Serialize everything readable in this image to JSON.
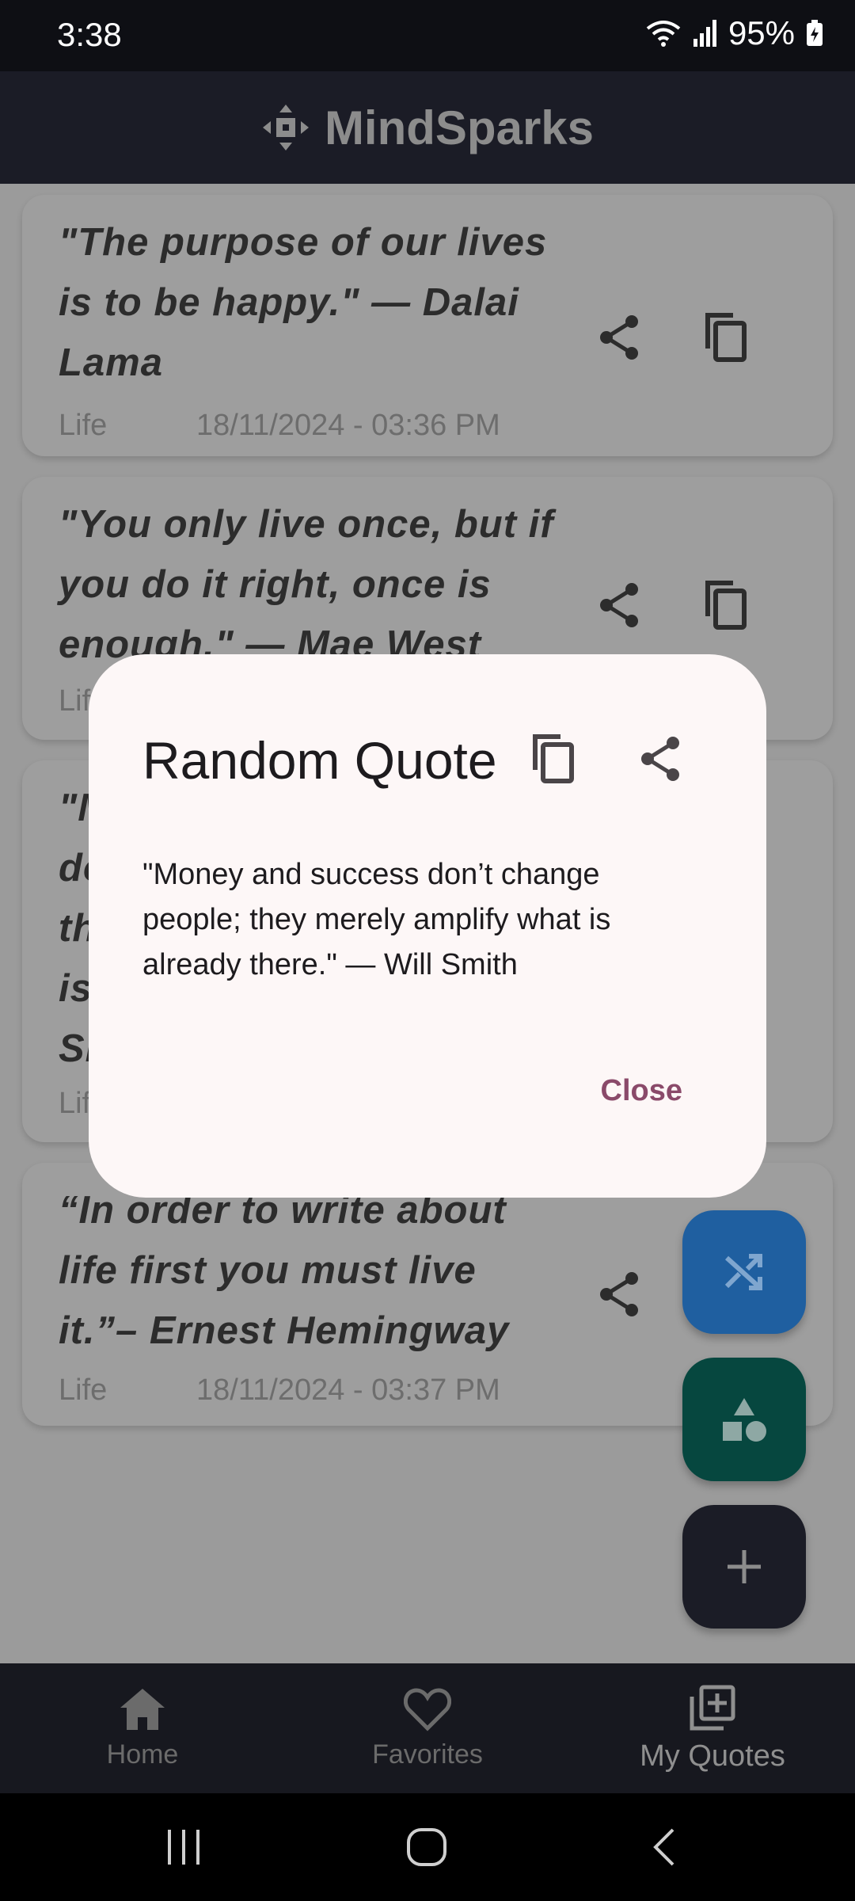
{
  "status_bar": {
    "time": "3:38",
    "battery": "95%"
  },
  "app_bar": {
    "title": "MindSparks"
  },
  "quotes": [
    {
      "text": "\"The purpose of our lives is to be happy.\" — Dalai Lama",
      "category": "Life",
      "date": "18/11/2024 - 03:36 PM"
    },
    {
      "text": "\"You only live once, but if you do it right, once is enough.\" — Mae West",
      "category": "Life",
      "date": ""
    },
    {
      "text": "\"M do th is Sm",
      "category": "Life",
      "date": ""
    },
    {
      "text": "“In order to write about life first you must live it.”– Ernest Hemingway",
      "category": "Life",
      "date": "18/11/2024 - 03:37 PM"
    }
  ],
  "dialog": {
    "title": "Random Quote",
    "text": "\"Money and success don’t change people; they merely amplify what is already there.\" — Will Smith",
    "close_label": "Close"
  },
  "bottom_nav": [
    {
      "label": "Home"
    },
    {
      "label": "Favorites"
    },
    {
      "label": "My Quotes"
    }
  ],
  "colors": {
    "fab_shuffle": "#1f72c6",
    "fab_categories": "#00574b",
    "fab_add": "#1b1c26",
    "accent": "#8a4a6a"
  }
}
